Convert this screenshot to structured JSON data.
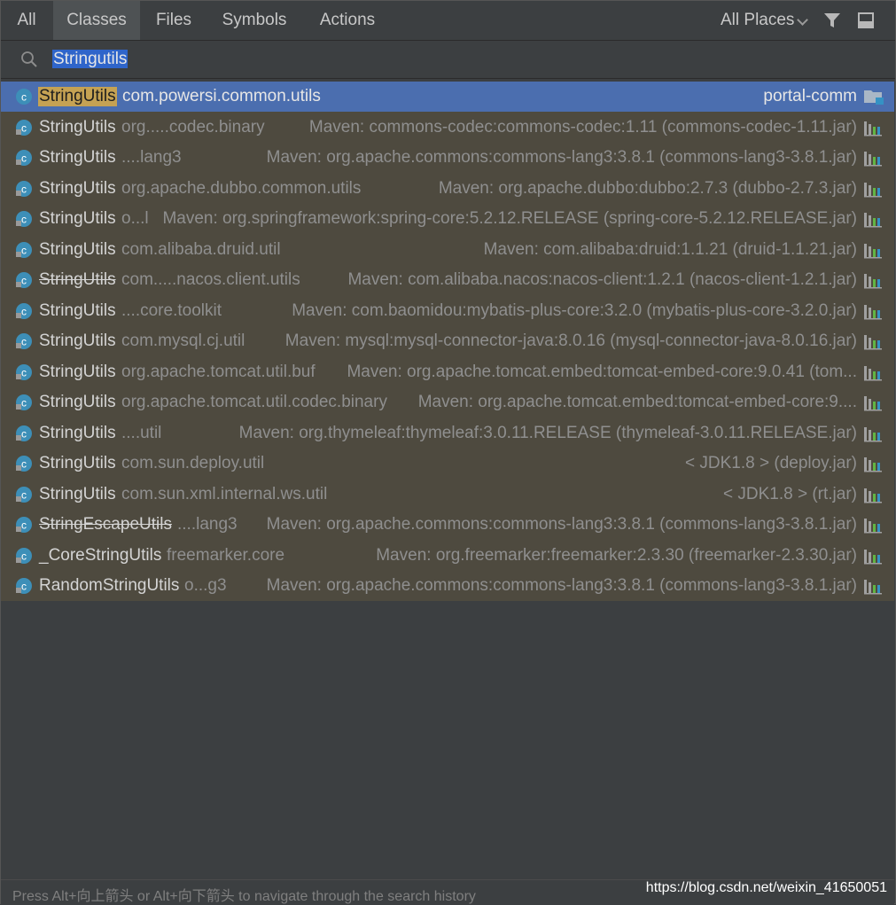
{
  "tabs": [
    {
      "label": "All"
    },
    {
      "label": "Classes",
      "active": true
    },
    {
      "label": "Files"
    },
    {
      "label": "Symbols"
    },
    {
      "label": "Actions"
    }
  ],
  "scope": {
    "label": "All Places"
  },
  "icons": {
    "filter": "filter-icon",
    "layout": "window-layout-icon",
    "search": "search-icon",
    "class": "class-icon",
    "library": "library-icon",
    "module": "module-folder-icon"
  },
  "colors": {
    "accent": "#4b6eaf",
    "match_highlight": "#c5a253",
    "results_bg": "#4e4a3f",
    "background": "#3c3f41",
    "class_icon": "#3d8fb8"
  },
  "search": {
    "query": "Stringutils"
  },
  "results": [
    {
      "name": "StringUtils",
      "package": "com.powersi.common.utils",
      "location": "portal-comm",
      "selected": true
    },
    {
      "name": "StringUtils",
      "package": "org.....codec.binary",
      "location": "Maven: commons-codec:commons-codec:1.11 (commons-codec-1.11.jar)"
    },
    {
      "name": "StringUtils",
      "package": "....lang3",
      "location": "Maven: org.apache.commons:commons-lang3:3.8.1 (commons-lang3-3.8.1.jar)"
    },
    {
      "name": "StringUtils",
      "package": "org.apache.dubbo.common.utils",
      "location": "Maven: org.apache.dubbo:dubbo:2.7.3 (dubbo-2.7.3.jar)"
    },
    {
      "name": "StringUtils",
      "package": "o...l",
      "location": "Maven: org.springframework:spring-core:5.2.12.RELEASE (spring-core-5.2.12.RELEASE.jar)"
    },
    {
      "name": "StringUtils",
      "package": "com.alibaba.druid.util",
      "location": "Maven: com.alibaba:druid:1.1.21 (druid-1.1.21.jar)"
    },
    {
      "name": "StringUtils",
      "package": "com.....nacos.client.utils",
      "location": "Maven: com.alibaba.nacos:nacos-client:1.2.1 (nacos-client-1.2.1.jar)",
      "deprecated": true
    },
    {
      "name": "StringUtils",
      "package": "....core.toolkit",
      "location": "Maven: com.baomidou:mybatis-plus-core:3.2.0 (mybatis-plus-core-3.2.0.jar)"
    },
    {
      "name": "StringUtils",
      "package": "com.mysql.cj.util",
      "location": "Maven: mysql:mysql-connector-java:8.0.16 (mysql-connector-java-8.0.16.jar)"
    },
    {
      "name": "StringUtils",
      "package": "org.apache.tomcat.util.buf",
      "location": "Maven: org.apache.tomcat.embed:tomcat-embed-core:9.0.41 (tom..."
    },
    {
      "name": "StringUtils",
      "package": "org.apache.tomcat.util.codec.binary",
      "location": "Maven: org.apache.tomcat.embed:tomcat-embed-core:9...."
    },
    {
      "name": "StringUtils",
      "package": "....util",
      "location": "Maven: org.thymeleaf:thymeleaf:3.0.11.RELEASE (thymeleaf-3.0.11.RELEASE.jar)"
    },
    {
      "name": "StringUtils",
      "package": "com.sun.deploy.util",
      "location": "< JDK1.8 > (deploy.jar)"
    },
    {
      "name": "StringUtils",
      "package": "com.sun.xml.internal.ws.util",
      "location": "< JDK1.8 > (rt.jar)"
    },
    {
      "name": "StringEscapeUtils",
      "package": "....lang3",
      "location": "Maven: org.apache.commons:commons-lang3:3.8.1 (commons-lang3-3.8.1.jar)",
      "deprecated": true
    },
    {
      "name": "_CoreStringUtils",
      "package": "freemarker.core",
      "location": "Maven: org.freemarker:freemarker:2.3.30 (freemarker-2.3.30.jar)"
    },
    {
      "name": "RandomStringUtils",
      "package": "o...g3",
      "location": "Maven: org.apache.commons:commons-lang3:3.8.1 (commons-lang3-3.8.1.jar)"
    }
  ],
  "footer": {
    "hint": "Press Alt+向上箭头 or Alt+向下箭头 to navigate through the search history",
    "watermark": "https://blog.csdn.net/weixin_41650051"
  }
}
